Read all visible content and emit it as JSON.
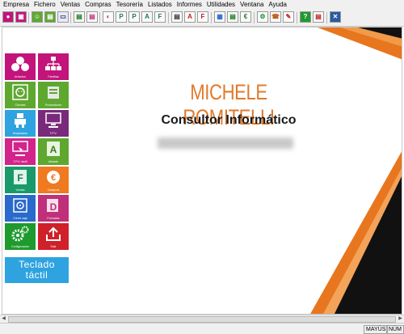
{
  "menu": [
    "Empresa",
    "Fichero",
    "Ventas",
    "Compras",
    "Tesorería",
    "Listados",
    "Informes",
    "Utilidades",
    "Ventana",
    "Ayuda"
  ],
  "toolbar_icons": [
    "articulos-icon",
    "familias-icon",
    "clientes-icon",
    "proveedores-icon",
    "tpv-icon",
    "albaranes-icon",
    "facturas-icon",
    "informes-icon",
    "presupuestos-icon",
    "pedidos-icon",
    "tickets-icon",
    "albaran-a-icon",
    "factura-f-icon",
    "albaran-compra-icon",
    "factura-compra-icon",
    "calculadora-icon",
    "euro-icon",
    "agenda-icon",
    "configuracion-icon",
    "telefono-icon",
    "cobros-icon",
    "ayuda-icon",
    "calendario-icon",
    "tools-icon"
  ],
  "tiles": [
    {
      "label": "Artículos",
      "color": "#c2147a",
      "icon": "articulos-icon",
      "glyph": "●●●"
    },
    {
      "label": "Familias",
      "color": "#c2147a",
      "icon": "familias-icon",
      "glyph": "▣"
    },
    {
      "label": "Clientes",
      "color": "#5fa830",
      "icon": "clientes-icon",
      "glyph": "☺"
    },
    {
      "label": "Proveedores",
      "color": "#5fa830",
      "icon": "proveedores-icon",
      "glyph": "▤"
    },
    {
      "label": "Empleados",
      "color": "#2ea3e0",
      "icon": "empleados-icon",
      "glyph": "웃"
    },
    {
      "label": "T.P.V.",
      "color": "#7a2a7a",
      "icon": "tpv-icon",
      "glyph": "▭"
    },
    {
      "label": "T.P.V. táctil",
      "color": "#d2248a",
      "icon": "tpv-tactil-icon",
      "glyph": "▭"
    },
    {
      "label": "Albarán",
      "color": "#5fa830",
      "icon": "albaran-icon",
      "glyph": "A"
    },
    {
      "label": "Ventas",
      "color": "#1a9a6a",
      "icon": "ventas-icon",
      "glyph": "F"
    },
    {
      "label": "Compras",
      "color": "#f07a20",
      "icon": "compras-icon",
      "glyph": "€"
    },
    {
      "label": "Cierre caja",
      "color": "#2a6acc",
      "icon": "cierre-caja-icon",
      "glyph": "▣"
    },
    {
      "label": "Formatos",
      "color": "#c0307a",
      "icon": "formatos-icon",
      "glyph": "D"
    },
    {
      "label": "Configuración",
      "color": "#1e9a2e",
      "icon": "configuracion-icon",
      "glyph": "⚙"
    },
    {
      "label": "Salir",
      "color": "#d0202a",
      "icon": "salir-icon",
      "glyph": "⇧"
    }
  ],
  "teclado": {
    "line1": "Teclado",
    "line2": "táctil"
  },
  "main": {
    "title": "MICHELE ROMITELLI",
    "subtitle": "Consultor Informático"
  },
  "colors": {
    "orange": "#e8761e",
    "dark": "#111111",
    "accent": "#e07a2c"
  },
  "status": {
    "mayus": "MAYÚS",
    "num": "NÚM"
  }
}
